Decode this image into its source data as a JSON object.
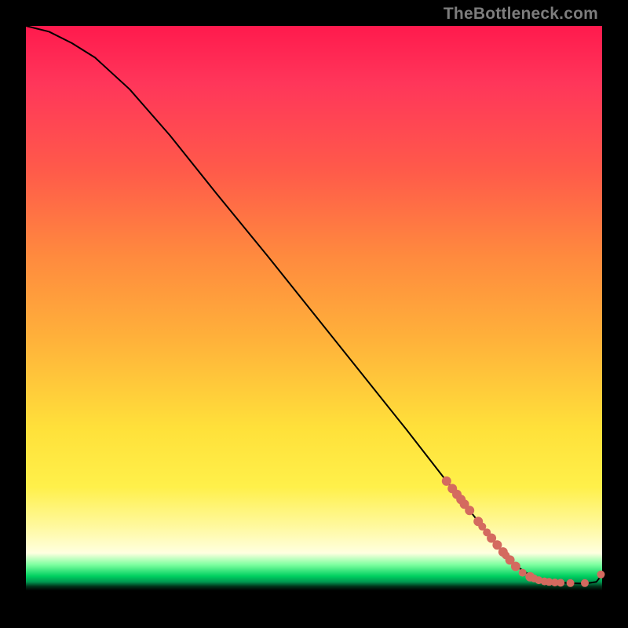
{
  "watermark": "TheBottleneck.com",
  "chart_data": {
    "type": "line",
    "title": "",
    "xlabel": "",
    "ylabel": "",
    "xlim": [
      0,
      100
    ],
    "ylim": [
      0,
      100
    ],
    "grid": false,
    "series": [
      {
        "name": "curve",
        "x": [
          0,
          4,
          8,
          12,
          18,
          25,
          33,
          42,
          50,
          58,
          66,
          73,
          78.5,
          81,
          83,
          85.5,
          88,
          91,
          94,
          97,
          99,
          100
        ],
        "y": [
          100,
          99,
          97,
          94.5,
          89,
          81,
          71,
          60,
          50,
          40,
          30,
          21,
          14,
          11,
          8.5,
          6,
          4.3,
          3.6,
          3.3,
          3.2,
          3.5,
          4.8
        ]
      }
    ],
    "markers": [
      {
        "x": 73.0,
        "y": 21.0,
        "r": 1.2
      },
      {
        "x": 74.0,
        "y": 19.7,
        "r": 1.2
      },
      {
        "x": 74.8,
        "y": 18.7,
        "r": 1.2
      },
      {
        "x": 75.5,
        "y": 17.8,
        "r": 1.2
      },
      {
        "x": 76.1,
        "y": 17.0,
        "r": 1.2
      },
      {
        "x": 77.0,
        "y": 15.9,
        "r": 1.2
      },
      {
        "x": 78.5,
        "y": 14.0,
        "r": 1.2
      },
      {
        "x": 79.2,
        "y": 13.1,
        "r": 1.0
      },
      {
        "x": 80.0,
        "y": 12.1,
        "r": 1.0
      },
      {
        "x": 80.8,
        "y": 11.1,
        "r": 1.2
      },
      {
        "x": 81.8,
        "y": 9.9,
        "r": 1.2
      },
      {
        "x": 82.8,
        "y": 8.7,
        "r": 1.2
      },
      {
        "x": 83.3,
        "y": 8.1,
        "r": 1.0
      },
      {
        "x": 84.0,
        "y": 7.3,
        "r": 1.2
      },
      {
        "x": 85.0,
        "y": 6.2,
        "r": 1.2
      },
      {
        "x": 86.2,
        "y": 5.1,
        "r": 1.0
      },
      {
        "x": 87.5,
        "y": 4.4,
        "r": 1.2
      },
      {
        "x": 88.2,
        "y": 4.1,
        "r": 1.0
      },
      {
        "x": 89.0,
        "y": 3.8,
        "r": 1.0
      },
      {
        "x": 90.0,
        "y": 3.6,
        "r": 1.0
      },
      {
        "x": 90.8,
        "y": 3.5,
        "r": 1.0
      },
      {
        "x": 91.8,
        "y": 3.4,
        "r": 1.0
      },
      {
        "x": 92.8,
        "y": 3.35,
        "r": 1.0
      },
      {
        "x": 94.5,
        "y": 3.3,
        "r": 1.0
      },
      {
        "x": 97.0,
        "y": 3.3,
        "r": 1.0
      },
      {
        "x": 99.8,
        "y": 4.8,
        "r": 1.0
      }
    ],
    "marker_color": "#d46a5f",
    "line_color": "#000000"
  }
}
